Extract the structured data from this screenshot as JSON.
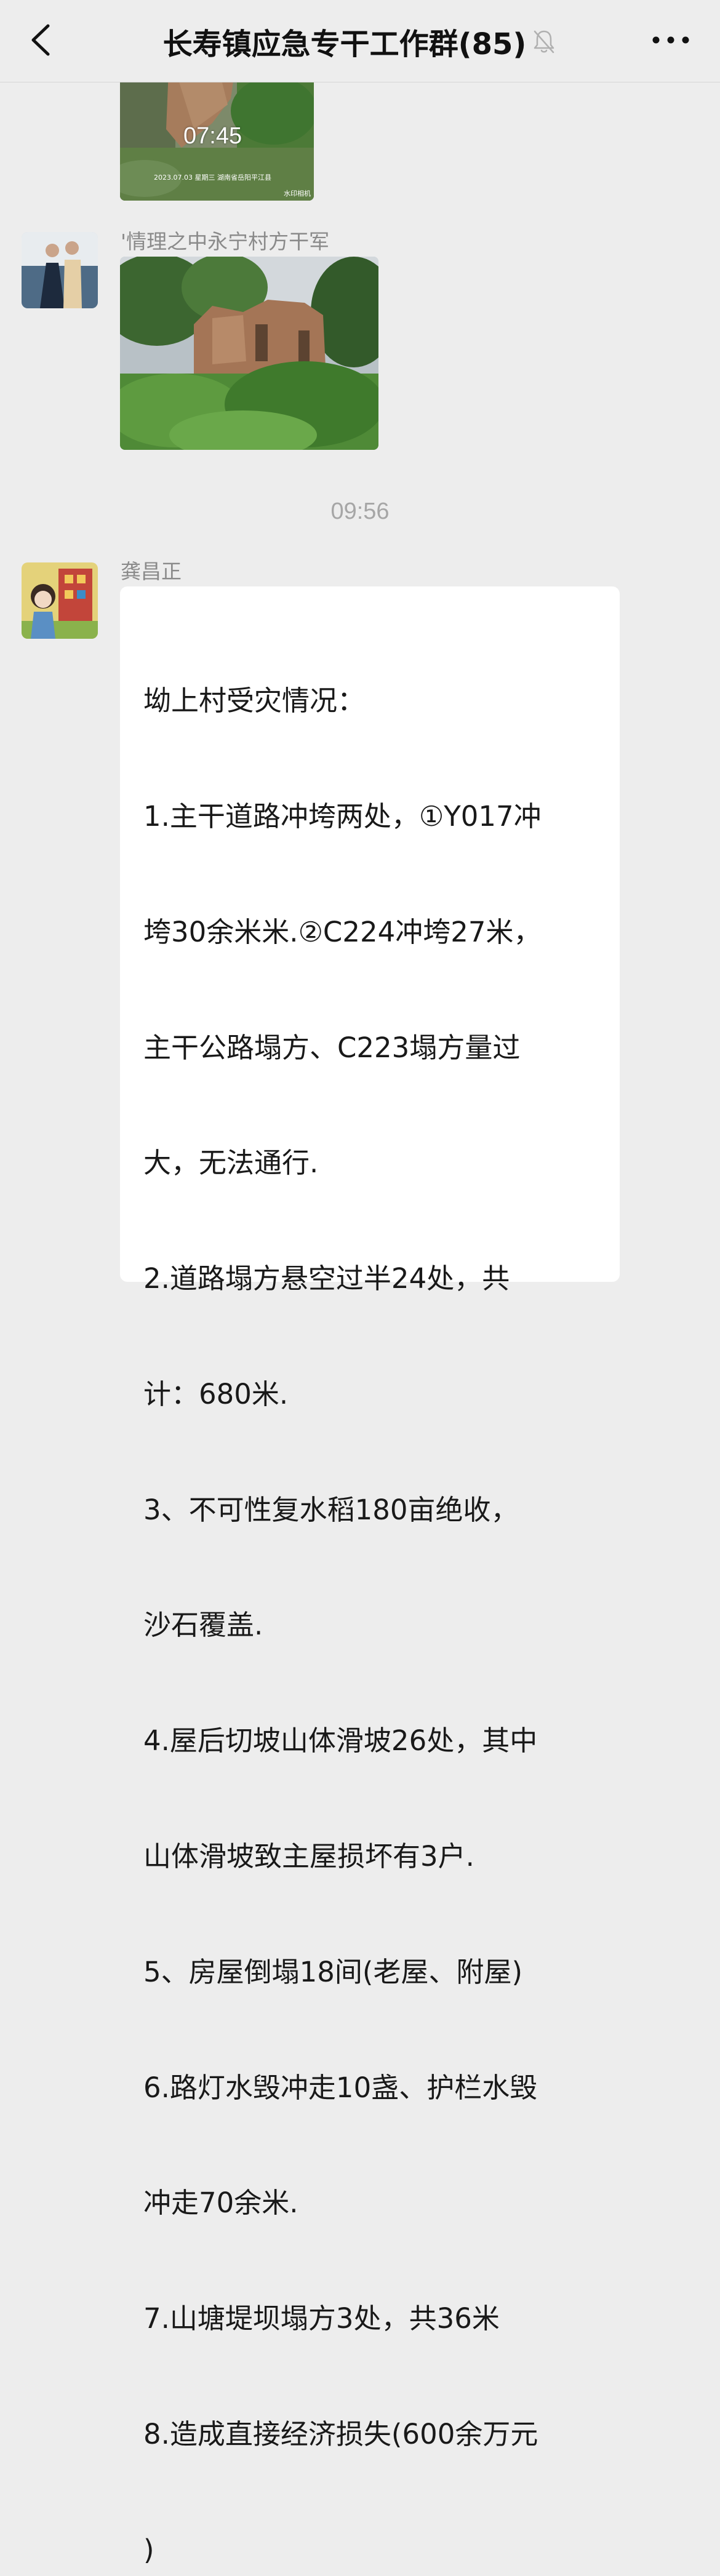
{
  "header": {
    "title": "长寿镇应急专干工作群(85)",
    "back_icon": "chevron-left-icon",
    "muted_icon": "bell-off-icon",
    "more_icon": "ellipsis-icon"
  },
  "messages": [
    {
      "type": "image",
      "overlay_time": "07:45",
      "overlay_caption": "2023.07.03 星期三  湖南省岳阳平江县",
      "overlay_brand": "水印相机"
    },
    {
      "type": "image",
      "sender": "'情理之中永宁村方干军"
    },
    {
      "type": "time",
      "time": "09:56"
    },
    {
      "type": "text",
      "sender": "龚昌正",
      "lines": [
        "坳上村受灾情况：",
        "1.主干道路冲垮两处，①Y017冲",
        "垮30余米米.②C224冲垮27米，",
        "主干公路塌方、C223塌方量过",
        "大，无法通行.",
        "2.道路塌方悬空过半24处，共",
        "计：680米.",
        "3、不可性复水稻180亩绝收，",
        "沙石覆盖.",
        "4.屋后切坡山体滑坡26处，其中",
        "山体滑坡致主屋损坏有3户.",
        "5、房屋倒塌18间(老屋、附屋)",
        "6.路灯水毁冲走10盏、护栏水毁",
        "冲走70余米.",
        "7.山塘堤坝塌方3处，共36米",
        "8.造成直接经济损失(600余万元",
        ")"
      ]
    }
  ],
  "colors": {
    "background": "#ededed",
    "bubble": "#ffffff",
    "sender_name": "#8a8a8a",
    "time_separator": "#a6a6a6"
  }
}
